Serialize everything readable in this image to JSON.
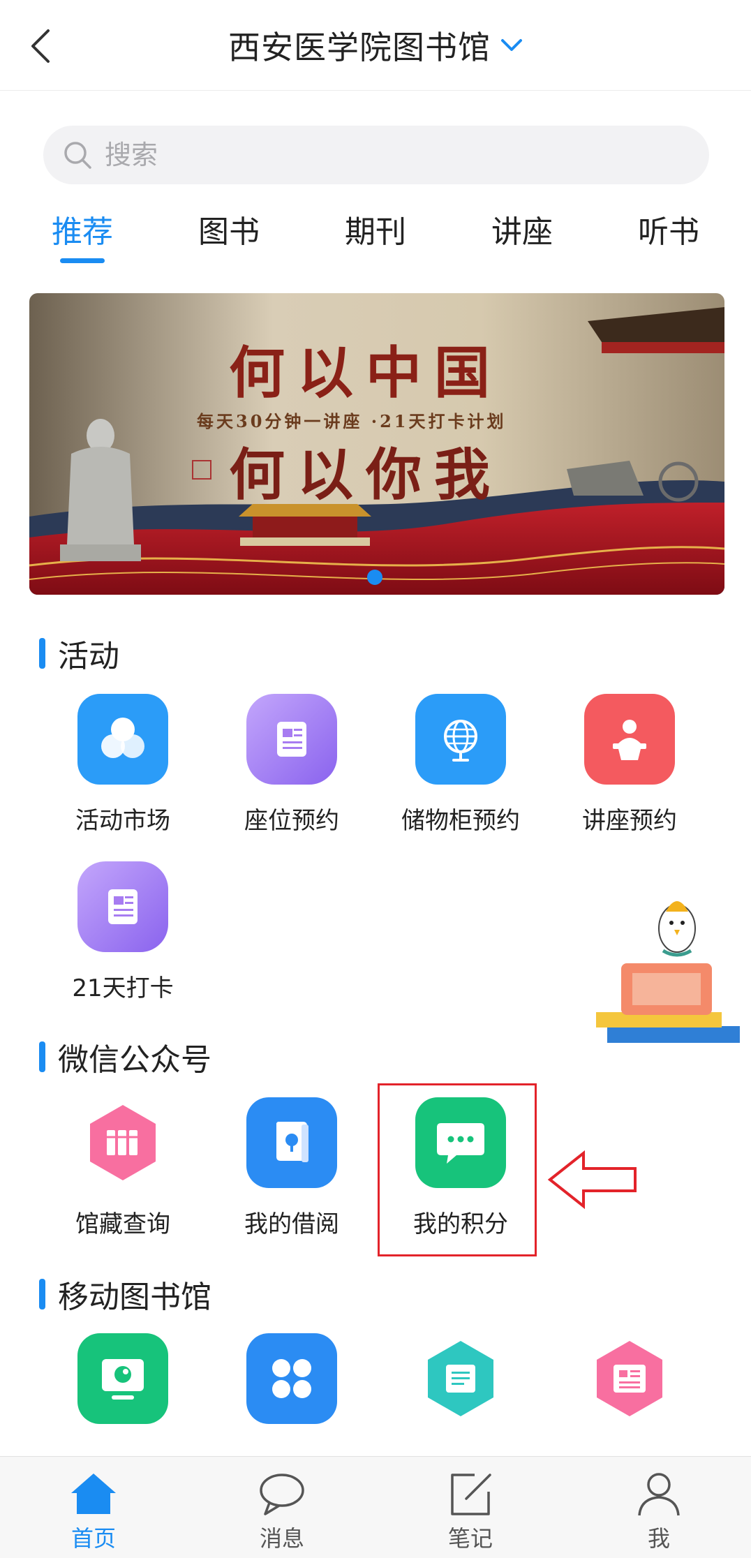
{
  "header": {
    "title": "西安医学院图书馆"
  },
  "search": {
    "placeholder": "搜索"
  },
  "tabs": [
    {
      "label": "推荐",
      "active": true
    },
    {
      "label": "图书",
      "active": false
    },
    {
      "label": "期刊",
      "active": false
    },
    {
      "label": "讲座",
      "active": false
    },
    {
      "label": "听书",
      "active": false
    }
  ],
  "banner": {
    "line1": "何以中国",
    "subtitle": "每天30分钟一讲座 ·21天打卡计划",
    "line2": "何以你我",
    "page_indicator": {
      "current": 1,
      "total": 1
    }
  },
  "sections": {
    "activities": {
      "title": "活动",
      "items": [
        {
          "label": "活动市场",
          "icon": "circles-icon",
          "color": "#2b9cf8"
        },
        {
          "label": "座位预约",
          "icon": "document-icon",
          "color": "#a77cf1"
        },
        {
          "label": "储物柜预约",
          "icon": "globe-icon",
          "color": "#2b9cf8"
        },
        {
          "label": "讲座预约",
          "icon": "lecturer-icon",
          "color": "#f45a5f"
        },
        {
          "label": "21天打卡",
          "icon": "document-icon",
          "color": "#a77cf1"
        }
      ]
    },
    "wechat": {
      "title": "微信公众号",
      "items": [
        {
          "label": "馆藏查询",
          "icon": "books-icon",
          "color": "#f86fa0"
        },
        {
          "label": "我的借阅",
          "icon": "book-icon",
          "color": "#2b8cf3"
        },
        {
          "label": "我的积分",
          "icon": "chat-icon",
          "color": "#17c37b"
        }
      ]
    },
    "mobile_library": {
      "title": "移动图书馆",
      "items": [
        {
          "label": "",
          "icon": "screen-icon",
          "color": "#17c37b"
        },
        {
          "label": "",
          "icon": "grid-icon",
          "color": "#2b8cf3"
        },
        {
          "label": "",
          "icon": "scroll-icon",
          "color": "#2ec7c0"
        },
        {
          "label": "",
          "icon": "news-icon",
          "color": "#f86fa0"
        }
      ]
    }
  },
  "bottom_nav": [
    {
      "label": "首页",
      "icon": "home-icon",
      "active": true
    },
    {
      "label": "消息",
      "icon": "message-icon",
      "active": false
    },
    {
      "label": "笔记",
      "icon": "note-icon",
      "active": false
    },
    {
      "label": "我",
      "icon": "person-icon",
      "active": false
    }
  ],
  "colors": {
    "accent": "#1a8cf2",
    "highlight": "#e3232a"
  }
}
